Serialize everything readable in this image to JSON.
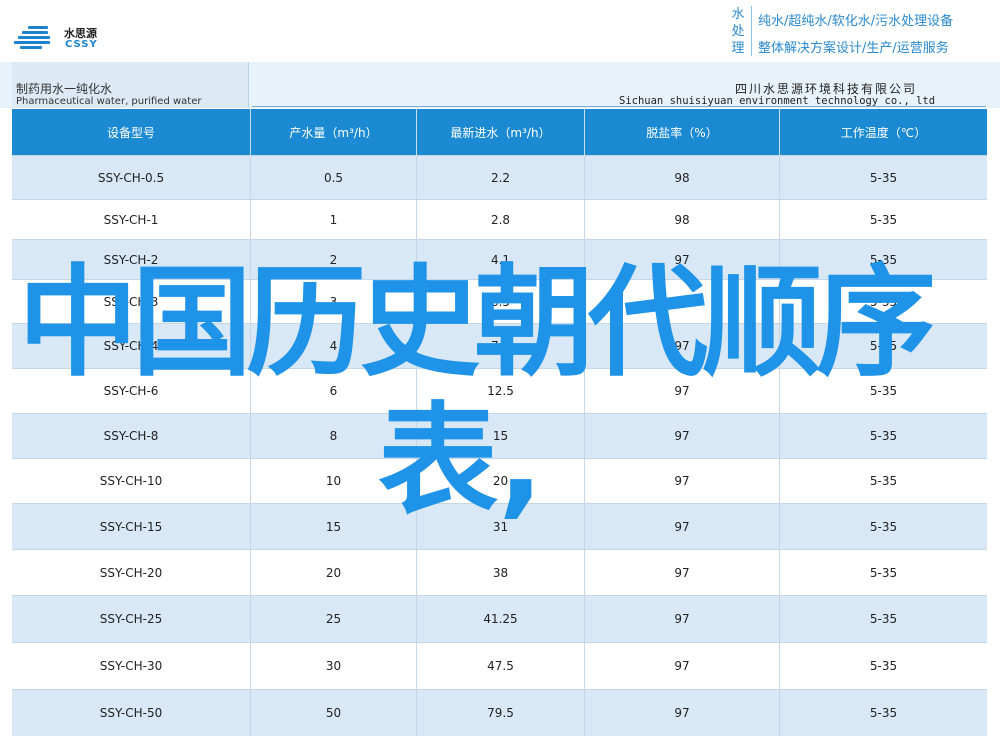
{
  "header": {
    "logo": {
      "cn": "水思源",
      "en": "CSSY"
    },
    "vertical_title": [
      "水",
      "处",
      "理"
    ],
    "slogans": [
      "纯水/超纯水/软化水/污水处理设备",
      "整体解决方案设计/生产/运营服务"
    ]
  },
  "band": {
    "left_cn": "制药用水一纯化水",
    "left_en": "Pharmaceutical water, purified water",
    "company_cn": "四川水思源环境科技有限公司",
    "company_en": "Sichuan shuisiyuan environment technology co., ltd"
  },
  "table": {
    "headers": [
      "设备型号",
      "产水量（m³/h）",
      "最新进水（m³/h）",
      "脱盐率（%）",
      "工作温度（℃）"
    ],
    "rows": [
      [
        "SSY-CH-0.5",
        "0.5",
        "2.2",
        "98",
        "5-35"
      ],
      [
        "SSY-CH-1",
        "1",
        "2.8",
        "98",
        "5-35"
      ],
      [
        "SSY-CH-2",
        "2",
        "4.1",
        "97",
        "5-35"
      ],
      [
        "SSY-CH-3",
        "3",
        "6.5",
        "97",
        "5-35"
      ],
      [
        "SSY-CH-4",
        "4",
        "7.8",
        "97",
        "5-35"
      ],
      [
        "SSY-CH-6",
        "6",
        "12.5",
        "97",
        "5-35"
      ],
      [
        "SSY-CH-8",
        "8",
        "15",
        "97",
        "5-35"
      ],
      [
        "SSY-CH-10",
        "10",
        "20",
        "97",
        "5-35"
      ],
      [
        "SSY-CH-15",
        "15",
        "31",
        "97",
        "5-35"
      ],
      [
        "SSY-CH-20",
        "20",
        "38",
        "97",
        "5-35"
      ],
      [
        "SSY-CH-25",
        "25",
        "41.25",
        "97",
        "5-35"
      ],
      [
        "SSY-CH-30",
        "30",
        "47.5",
        "97",
        "5-35"
      ],
      [
        "SSY-CH-50",
        "50",
        "79.5",
        "97",
        "5-35"
      ]
    ]
  },
  "overlay": {
    "line1": "中国历史朝代顺序",
    "line2": "表,"
  },
  "colors": {
    "accent": "#1b8ad2",
    "overlay": "#1e93e8",
    "row_a": "#ffffff",
    "row_b": "#d8e8f6"
  }
}
